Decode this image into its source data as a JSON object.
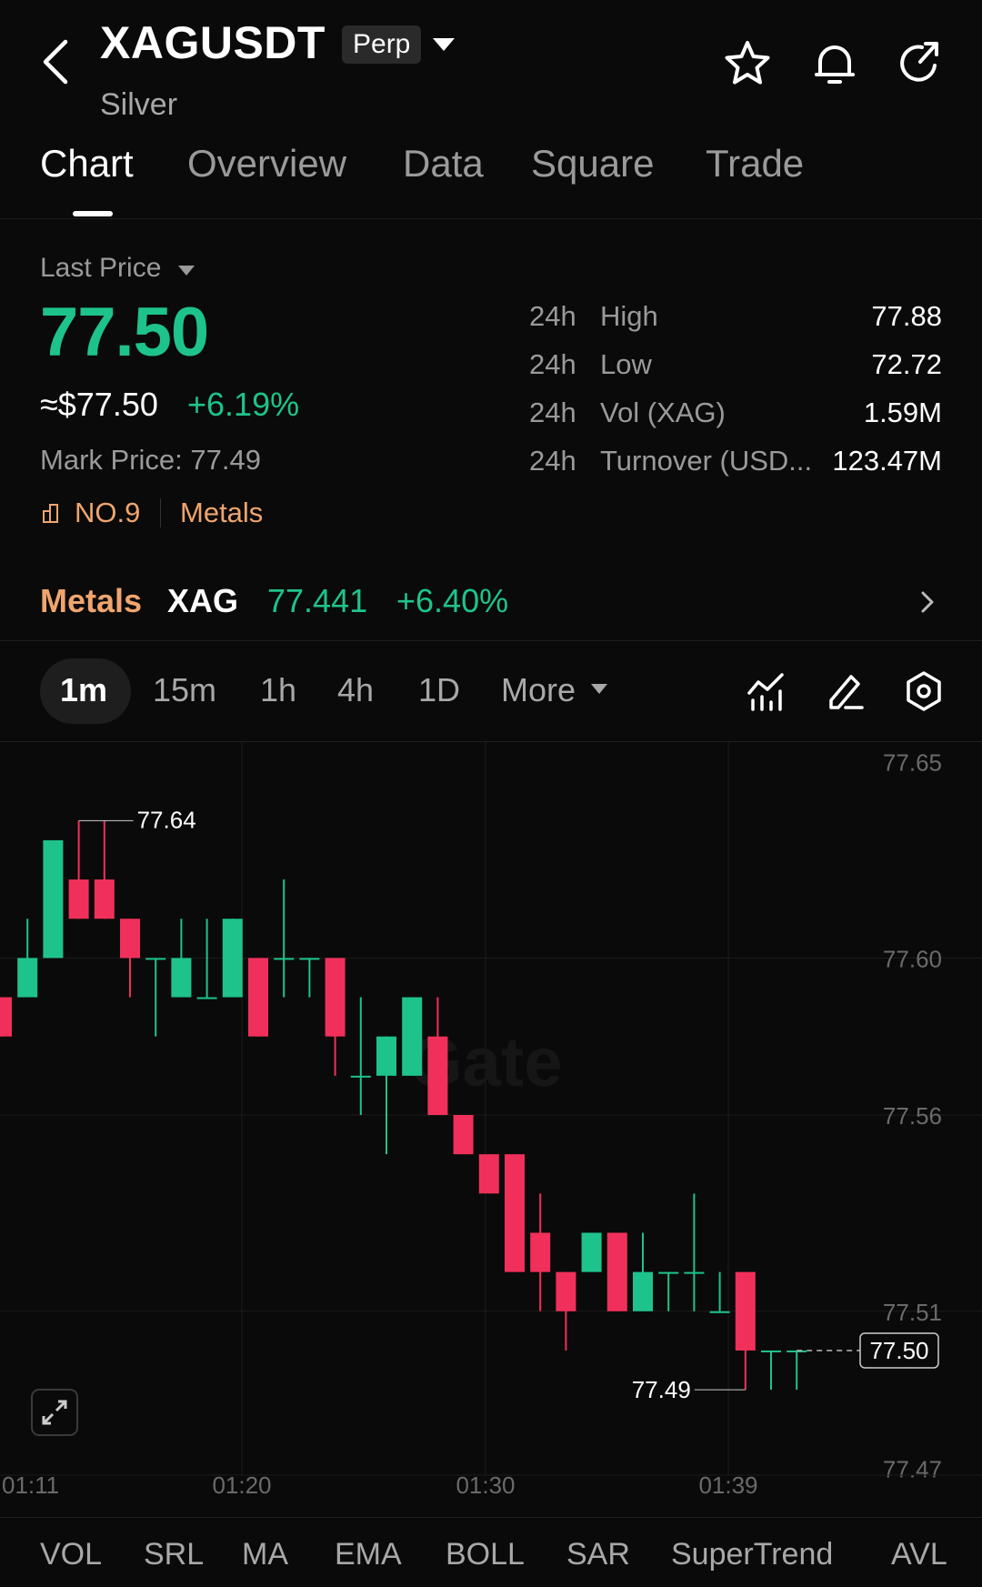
{
  "header": {
    "symbol": "XAGUSDT",
    "badge": "Perp",
    "name": "Silver",
    "icons": [
      "back-arrow-icon",
      "star-icon",
      "bell-icon",
      "share-icon"
    ]
  },
  "tabs": [
    "Chart",
    "Overview",
    "Data",
    "Square",
    "Trade"
  ],
  "price": {
    "label": "Last Price",
    "value": "77.50",
    "usd": "≈$77.50",
    "change": "+6.19%",
    "mark": "Mark Price: 77.49",
    "rank": "NO.9",
    "category": "Metals"
  },
  "stats": [
    {
      "k1": "24h",
      "k2": "High",
      "v": "77.88"
    },
    {
      "k1": "24h",
      "k2": "Low",
      "v": "72.72"
    },
    {
      "k1": "24h",
      "k2": "Vol (XAG)",
      "v": "1.59M"
    },
    {
      "k1": "24h",
      "k2": "Turnover (USD...",
      "v": "123.47M"
    }
  ],
  "sector": {
    "category": "Metals",
    "symbol": "XAG",
    "price": "77.441",
    "change": "+6.40%"
  },
  "intervals": [
    "1m",
    "15m",
    "1h",
    "4h",
    "1D",
    "More"
  ],
  "colors": {
    "up": "#1ec38c",
    "down": "#f0305a",
    "accent": "#f0a56e",
    "bg": "#0a0a0a"
  },
  "chart_data": {
    "type": "candlestick",
    "price_ticks": [
      "77.65",
      "77.60",
      "77.56",
      "77.51",
      "77.47"
    ],
    "time_ticks": [
      "01:11",
      "01:20",
      "01:30",
      "01:39"
    ],
    "high_label": "77.64",
    "low_label": "77.49",
    "last_label": "77.50",
    "watermark": "Gate",
    "candles": [
      {
        "o": 77.59,
        "c": 77.58,
        "h": 77.59,
        "l": 77.58
      },
      {
        "o": 77.59,
        "c": 77.6,
        "h": 77.61,
        "l": 77.59
      },
      {
        "o": 77.6,
        "c": 77.63,
        "h": 77.63,
        "l": 77.6
      },
      {
        "o": 77.62,
        "c": 77.61,
        "h": 77.635,
        "l": 77.61
      },
      {
        "o": 77.62,
        "c": 77.61,
        "h": 77.635,
        "l": 77.61
      },
      {
        "o": 77.61,
        "c": 77.6,
        "h": 77.61,
        "l": 77.59
      },
      {
        "o": 77.6,
        "c": 77.6,
        "h": 77.6,
        "l": 77.58
      },
      {
        "o": 77.59,
        "c": 77.6,
        "h": 77.61,
        "l": 77.59
      },
      {
        "o": 77.59,
        "c": 77.59,
        "h": 77.61,
        "l": 77.59
      },
      {
        "o": 77.59,
        "c": 77.61,
        "h": 77.61,
        "l": 77.59
      },
      {
        "o": 77.6,
        "c": 77.58,
        "h": 77.6,
        "l": 77.58
      },
      {
        "o": 77.6,
        "c": 77.6,
        "h": 77.62,
        "l": 77.59
      },
      {
        "o": 77.6,
        "c": 77.6,
        "h": 77.6,
        "l": 77.59
      },
      {
        "o": 77.6,
        "c": 77.58,
        "h": 77.6,
        "l": 77.57
      },
      {
        "o": 77.57,
        "c": 77.57,
        "h": 77.59,
        "l": 77.56
      },
      {
        "o": 77.57,
        "c": 77.58,
        "h": 77.58,
        "l": 77.55
      },
      {
        "o": 77.57,
        "c": 77.59,
        "h": 77.59,
        "l": 77.57
      },
      {
        "o": 77.58,
        "c": 77.56,
        "h": 77.59,
        "l": 77.56
      },
      {
        "o": 77.56,
        "c": 77.55,
        "h": 77.56,
        "l": 77.55
      },
      {
        "o": 77.55,
        "c": 77.54,
        "h": 77.55,
        "l": 77.54
      },
      {
        "o": 77.55,
        "c": 77.52,
        "h": 77.55,
        "l": 77.52
      },
      {
        "o": 77.53,
        "c": 77.52,
        "h": 77.54,
        "l": 77.51
      },
      {
        "o": 77.52,
        "c": 77.51,
        "h": 77.52,
        "l": 77.5
      },
      {
        "o": 77.52,
        "c": 77.53,
        "h": 77.53,
        "l": 77.52
      },
      {
        "o": 77.53,
        "c": 77.51,
        "h": 77.53,
        "l": 77.51
      },
      {
        "o": 77.51,
        "c": 77.52,
        "h": 77.53,
        "l": 77.51
      },
      {
        "o": 77.52,
        "c": 77.52,
        "h": 77.52,
        "l": 77.51
      },
      {
        "o": 77.52,
        "c": 77.52,
        "h": 77.54,
        "l": 77.51
      },
      {
        "o": 77.51,
        "c": 77.51,
        "h": 77.52,
        "l": 77.51
      },
      {
        "o": 77.52,
        "c": 77.5,
        "h": 77.52,
        "l": 77.49
      },
      {
        "o": 77.5,
        "c": 77.5,
        "h": 77.5,
        "l": 77.49
      },
      {
        "o": 77.5,
        "c": 77.5,
        "h": 77.5,
        "l": 77.49
      }
    ]
  },
  "indicators": [
    "VOL",
    "SRL",
    "MA",
    "EMA",
    "BOLL",
    "SAR",
    "SuperTrend",
    "AVL"
  ]
}
